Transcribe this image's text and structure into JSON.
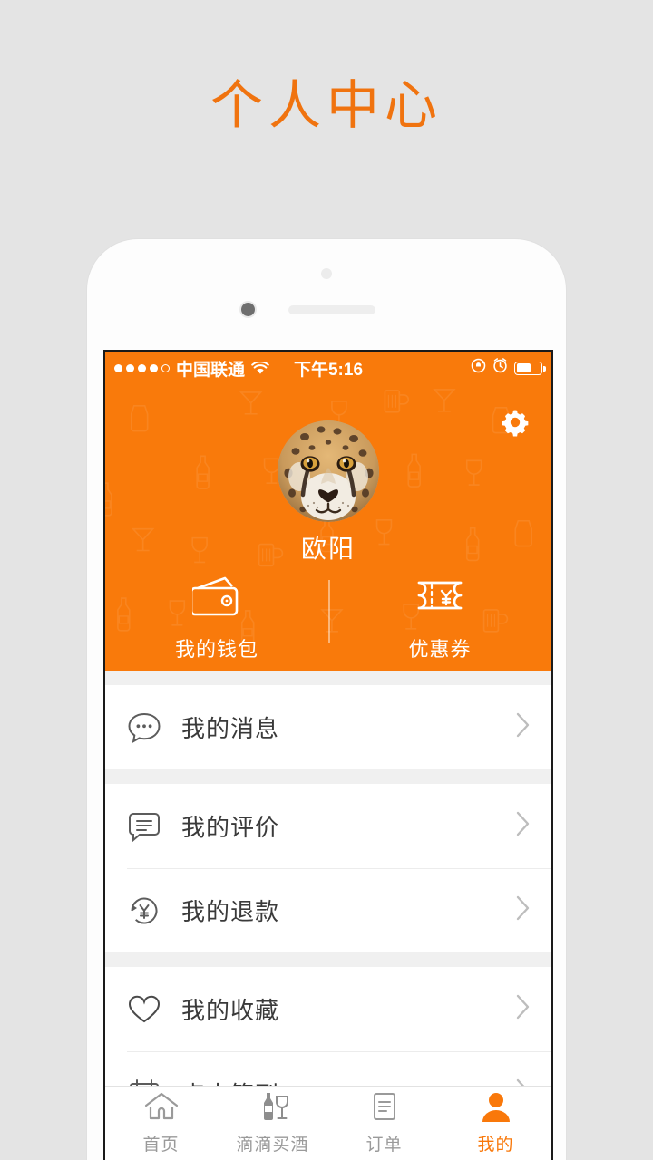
{
  "page": {
    "title": "个人中心",
    "background_color": "#e4e4e4",
    "accent_color": "#f0730f"
  },
  "status_bar": {
    "signal_dots_filled": 4,
    "signal_dots_total": 5,
    "carrier": "中国联通",
    "wifi_icon": "wifi-icon",
    "time": "下午5:16",
    "rotation_lock_icon": "rotation-lock-icon",
    "alarm_icon": "alarm-clock-icon",
    "battery_icon": "battery-icon",
    "battery_level_percent": 55,
    "background_color": "#f97a0b",
    "text_color": "#ffffff"
  },
  "header": {
    "background_color": "#f97a0b",
    "settings_icon": "gear-icon",
    "avatar_icon": "cheetah-avatar",
    "username": "欧阳",
    "watermark": "liquor-bottles-glasses-pattern",
    "quick_actions": [
      {
        "icon": "wallet-icon",
        "label": "我的钱包"
      },
      {
        "icon": "coupon-ticket-icon",
        "label": "优惠券"
      }
    ]
  },
  "menu": {
    "groups": [
      {
        "items": [
          {
            "icon": "chat-bubble-dots-icon",
            "label": "我的消息",
            "chevron": "chevron-right-icon"
          }
        ]
      },
      {
        "items": [
          {
            "icon": "comment-lines-icon",
            "label": "我的评价",
            "chevron": "chevron-right-icon"
          },
          {
            "icon": "refund-yen-icon",
            "label": "我的退款",
            "chevron": "chevron-right-icon"
          }
        ]
      },
      {
        "items": [
          {
            "icon": "heart-icon",
            "label": "我的收藏",
            "chevron": "chevron-right-icon"
          },
          {
            "icon": "calendar-check-icon",
            "label": "点击签到",
            "chevron": "chevron-right-icon"
          }
        ]
      }
    ]
  },
  "tabbar": {
    "active_index": 3,
    "active_color": "#f9780a",
    "inactive_color": "#9a9a9a",
    "tabs": [
      {
        "icon": "home-icon",
        "label": "首页"
      },
      {
        "icon": "bottle-glass-icon",
        "label": "滴滴买酒"
      },
      {
        "icon": "order-list-icon",
        "label": "订单"
      },
      {
        "icon": "person-icon",
        "label": "我的"
      }
    ]
  }
}
